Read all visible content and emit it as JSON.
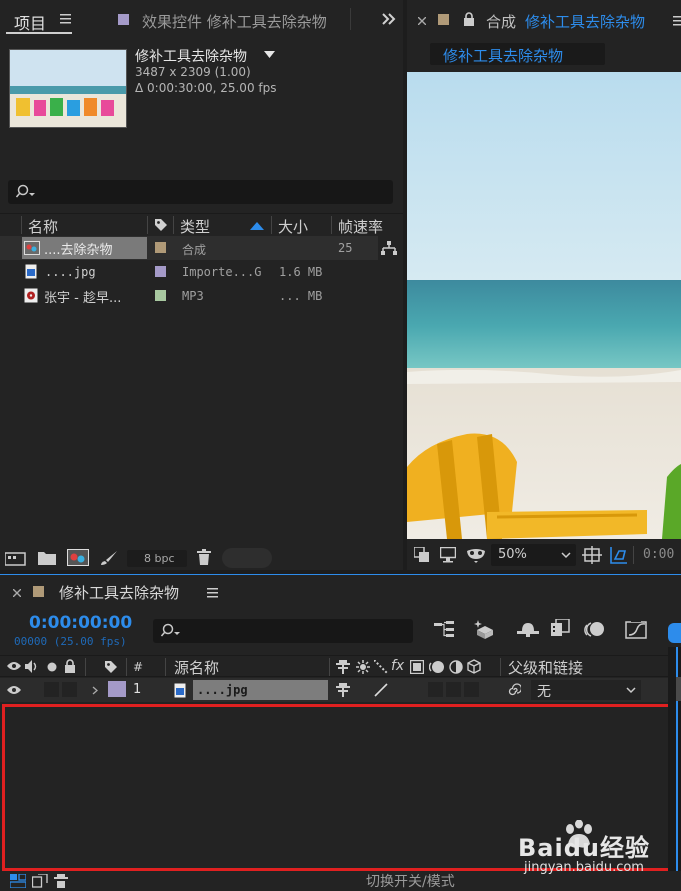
{
  "project_panel": {
    "tab_label": "项目",
    "effects_tab_label": "效果控件 修补工具去除杂物",
    "selected_name": "修补工具去除杂物",
    "selected_dims": "3487 x 2309 (1.00)",
    "selected_duration": "Δ 0:00:30:00, 25.00 fps",
    "columns": {
      "name": "名称",
      "type": "类型",
      "size": "大小",
      "fps": "帧速率"
    },
    "items": [
      {
        "name": "....去除杂物",
        "type": "合成",
        "size": "",
        "fps": "25",
        "color": "#b09a78"
      },
      {
        "name": "....jpg",
        "type": "Importe...G",
        "size": "1.6 MB",
        "fps": "",
        "color": "#a49ac8"
      },
      {
        "name": "张宇 - 趁早...",
        "type": "MP3",
        "size": "... MB",
        "fps": "",
        "color": "#a8c8a0"
      }
    ],
    "bpc_label": "8 bpc"
  },
  "composition_viewer": {
    "tab_label": "合成",
    "comp_name": "修补工具去除杂物",
    "comp_name_button": "修补工具去除杂物",
    "zoom_value": "50%",
    "timecode": "0:00"
  },
  "timeline": {
    "tab_label": "修补工具去除杂物",
    "timecode": "0:00:00:00",
    "frame_info": "00000 (25.00 fps)",
    "columns": {
      "hash": "#",
      "source_name": "源名称",
      "parent": "父级和链接"
    },
    "layers": [
      {
        "index": "1",
        "name": "....jpg",
        "parent": "无",
        "label_color": "#a49ac8"
      }
    ],
    "footer_label": "切换开关/模式"
  },
  "watermark": {
    "brand": "Baidu经验",
    "url": "jingyan.baidu.com"
  },
  "colors": {
    "accent_blue": "#2d8ceb",
    "highlight_red": "#e02020",
    "panel_bg": "#232323"
  }
}
